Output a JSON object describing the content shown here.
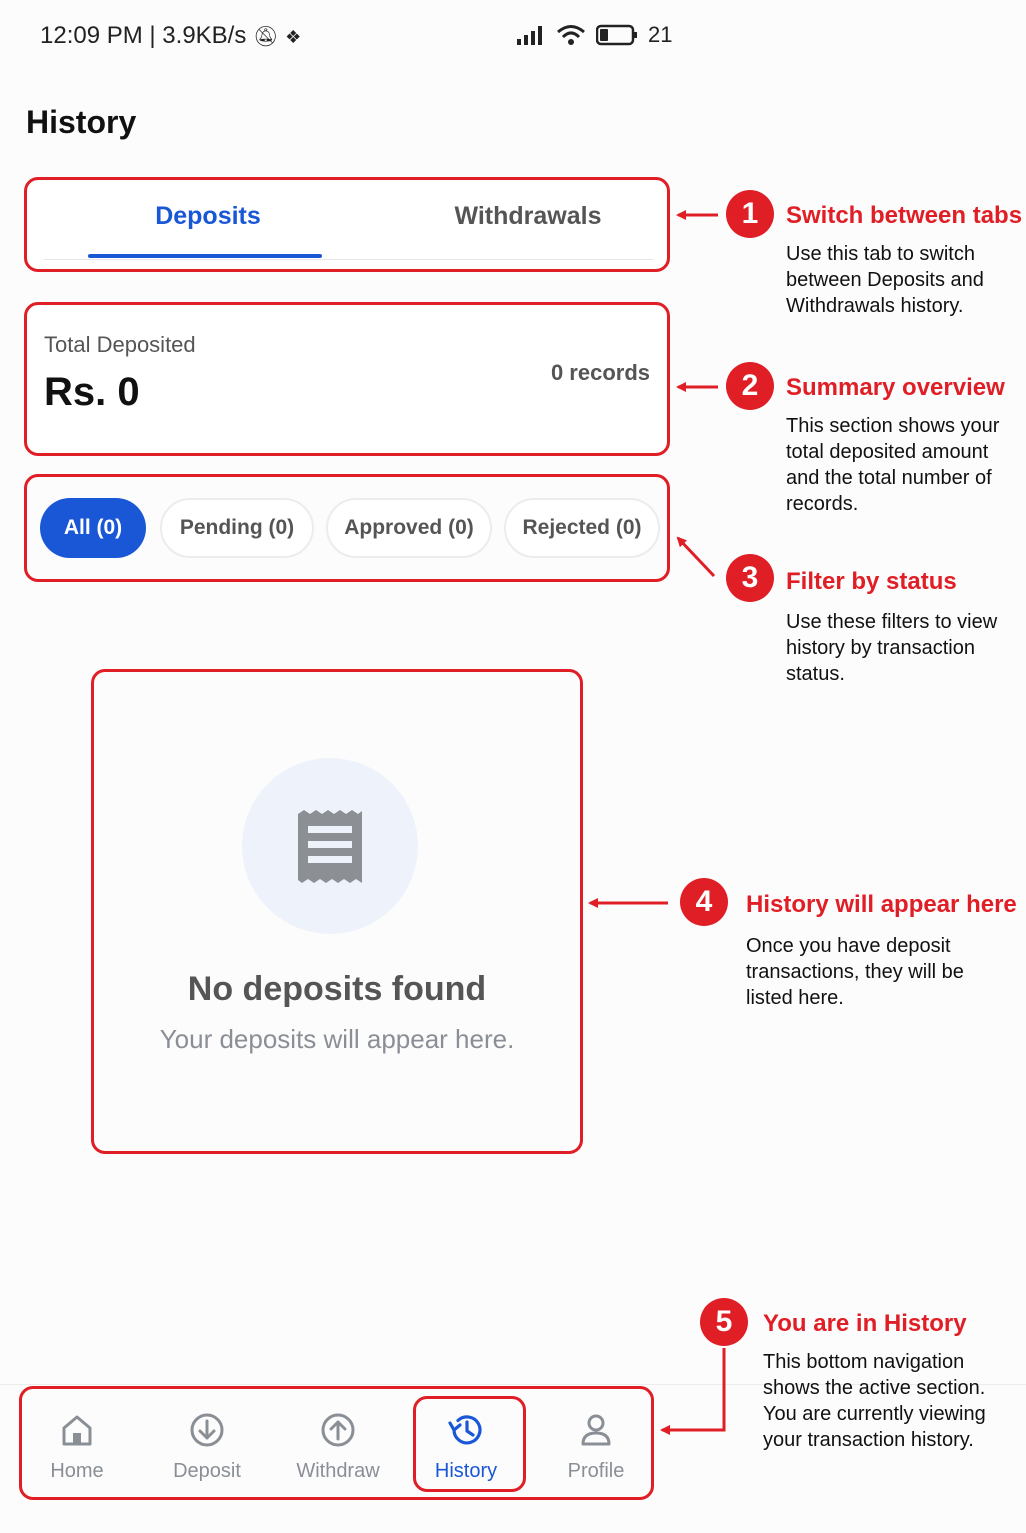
{
  "status_bar": {
    "time": "12:09 PM | 3.9KB/s",
    "battery": "21"
  },
  "page_title": "History",
  "tabs": [
    {
      "label": "Deposits",
      "active": true
    },
    {
      "label": "Withdrawals",
      "active": false
    }
  ],
  "summary": {
    "label": "Total Deposited",
    "amount": "Rs. 0",
    "records": "0 records"
  },
  "filters": [
    {
      "label": "All (0)",
      "active": true
    },
    {
      "label": "Pending (0)",
      "active": false
    },
    {
      "label": "Approved (0)",
      "active": false
    },
    {
      "label": "Rejected (0)",
      "active": false
    }
  ],
  "empty_state": {
    "title": "No deposits found",
    "subtitle": "Your deposits will appear here."
  },
  "nav": [
    {
      "label": "Home",
      "icon": "home-icon",
      "active": false
    },
    {
      "label": "Deposit",
      "icon": "deposit-icon",
      "active": false
    },
    {
      "label": "Withdraw",
      "icon": "withdraw-icon",
      "active": false
    },
    {
      "label": "History",
      "icon": "history-icon",
      "active": true
    },
    {
      "label": "Profile",
      "icon": "profile-icon",
      "active": false
    }
  ],
  "callouts": [
    {
      "number": "1",
      "title": "Switch between tabs",
      "body": "Use this tab to switch between Deposits and Withdrawals history."
    },
    {
      "number": "2",
      "title": "Summary overview",
      "body": "This section shows your total deposited amount and the total number of records."
    },
    {
      "number": "3",
      "title": "Filter by status",
      "body": "Use these filters to view history by transaction status."
    },
    {
      "number": "4",
      "title": "History will appear here",
      "body": "Once you have deposit transactions, they will be listed here."
    },
    {
      "number": "5",
      "title": "You are in History",
      "body": "This bottom navigation shows the active section. You are currently viewing your transaction history."
    }
  ],
  "colors": {
    "accent": "#1a57d6",
    "annotation": "#e01e25"
  }
}
